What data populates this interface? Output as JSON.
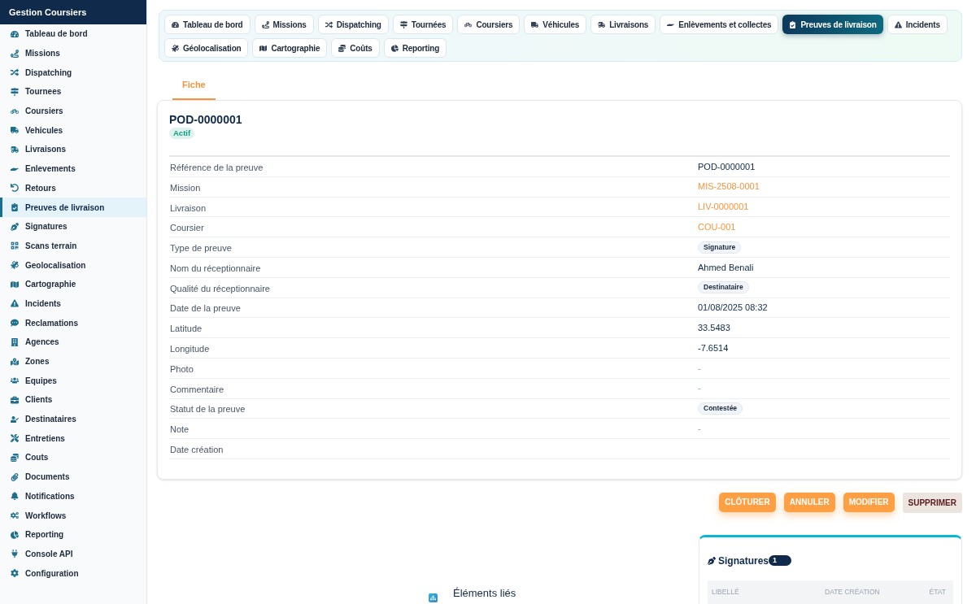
{
  "sidebar": {
    "title": "Gestion Coursiers",
    "items": [
      {
        "label": "Tableau de bord",
        "selected": false
      },
      {
        "label": "Missions",
        "selected": false
      },
      {
        "label": "Dispatching",
        "selected": false
      },
      {
        "label": "Tournees",
        "selected": false
      },
      {
        "label": "Coursiers",
        "selected": false
      },
      {
        "label": "Vehicules",
        "selected": false
      },
      {
        "label": "Livraisons",
        "selected": false
      },
      {
        "label": "Enlevements",
        "selected": false
      },
      {
        "label": "Retours",
        "selected": false
      },
      {
        "label": "Preuves de livraison",
        "selected": true
      },
      {
        "label": "Signatures",
        "selected": false
      },
      {
        "label": "Scans terrain",
        "selected": false
      },
      {
        "label": "Geolocalisation",
        "selected": false
      },
      {
        "label": "Cartographie",
        "selected": false
      },
      {
        "label": "Incidents",
        "selected": false
      },
      {
        "label": "Reclamations",
        "selected": false
      },
      {
        "label": "Agences",
        "selected": false
      },
      {
        "label": "Zones",
        "selected": false
      },
      {
        "label": "Equipes",
        "selected": false
      },
      {
        "label": "Clients",
        "selected": false
      },
      {
        "label": "Destinataires",
        "selected": false
      },
      {
        "label": "Entretiens",
        "selected": false
      },
      {
        "label": "Couts",
        "selected": false
      },
      {
        "label": "Documents",
        "selected": false
      },
      {
        "label": "Notifications",
        "selected": false
      },
      {
        "label": "Workflows",
        "selected": false
      },
      {
        "label": "Reporting",
        "selected": false
      },
      {
        "label": "Console API",
        "selected": false
      },
      {
        "label": "Configuration",
        "selected": false
      }
    ]
  },
  "module_tabs": [
    {
      "label": "Tableau de bord",
      "selected": false
    },
    {
      "label": "Missions",
      "selected": false
    },
    {
      "label": "Dispatching",
      "selected": false
    },
    {
      "label": "Tournées",
      "selected": false
    },
    {
      "label": "Coursiers",
      "selected": false
    },
    {
      "label": "Véhicules",
      "selected": false
    },
    {
      "label": "Livraisons",
      "selected": false
    },
    {
      "label": "Enlèvements et collectes",
      "selected": false
    },
    {
      "label": "Preuves de livraison",
      "selected": true
    },
    {
      "label": "Incidents",
      "selected": false
    },
    {
      "label": "Géolocalisation",
      "selected": false
    },
    {
      "label": "Cartographie",
      "selected": false
    },
    {
      "label": "Coûts",
      "selected": false
    },
    {
      "label": "Reporting",
      "selected": false
    }
  ],
  "view_tabs": [
    {
      "label": "Fiche",
      "selected": true
    }
  ],
  "record": {
    "title": "POD-0000001",
    "status": "Actif",
    "fields": [
      {
        "label": "Référence de la preuve",
        "value": "POD-0000001",
        "kind": "text"
      },
      {
        "label": "Mission",
        "value": "MIS-2508-0001",
        "kind": "link"
      },
      {
        "label": "Livraison",
        "value": "LIV-0000001",
        "kind": "link"
      },
      {
        "label": "Coursier",
        "value": "COU-001",
        "kind": "link"
      },
      {
        "label": "Type de preuve",
        "value": "Signature",
        "kind": "tag"
      },
      {
        "label": "Nom du réceptionnaire",
        "value": "Ahmed Benali",
        "kind": "text"
      },
      {
        "label": "Qualité du réceptionnaire",
        "value": "Destinataire",
        "kind": "tag"
      },
      {
        "label": "Date de la preuve",
        "value": "01/08/2025 08:32",
        "kind": "text"
      },
      {
        "label": "Latitude",
        "value": "33.5483",
        "kind": "text"
      },
      {
        "label": "Longitude",
        "value": "-7.6514",
        "kind": "text"
      },
      {
        "label": "Photo",
        "value": "-",
        "kind": "empty"
      },
      {
        "label": "Commentaire",
        "value": "-",
        "kind": "empty"
      },
      {
        "label": "Statut de la preuve",
        "value": "Contestée",
        "kind": "tag"
      },
      {
        "label": "Note",
        "value": "-",
        "kind": "empty"
      },
      {
        "label": "Date création"
      }
    ]
  },
  "actions": [
    {
      "label": "CLÔTURER",
      "kind": "primary"
    },
    {
      "label": "ANNULER",
      "kind": "primary"
    },
    {
      "label": "MODIFIER",
      "kind": "primary"
    },
    {
      "label": "SUPPRIMER",
      "kind": "danger"
    }
  ],
  "related": {
    "title": "Éléments liés"
  },
  "signatures_panel": {
    "title": "Signatures",
    "count": "1",
    "columns": [
      "LIBELLÉ",
      "DATE CRÉATION",
      "ÉTAT"
    ]
  }
}
